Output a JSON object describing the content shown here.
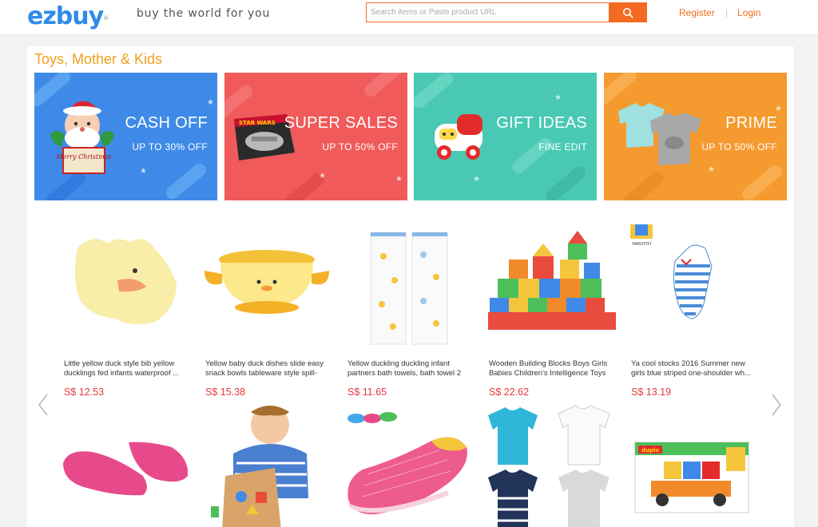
{
  "header": {
    "logo": "ezbuy",
    "tagline": "buy the world for you",
    "search_placeholder": "Search items or Paste product URL",
    "register": "Register",
    "separator": "|",
    "login": "Login"
  },
  "section": {
    "title": "Toys, Mother & Kids"
  },
  "banners": [
    {
      "headline": "CASH OFF",
      "sub": "UP TO 30% OFF",
      "color": "#3f8ae8",
      "art_text": "Merry Christmas"
    },
    {
      "headline": "SUPER SALES",
      "sub": "UP TO 50% OFF",
      "color": "#f05a5a",
      "art_text": "STAR WARS"
    },
    {
      "headline": "GIFT IDEAS",
      "sub": "FINE EDIT",
      "color": "#49c9b4",
      "art_text": ""
    },
    {
      "headline": "PRIME",
      "sub": "UP TO 50% OFF",
      "color": "#f59a2f",
      "art_text": ""
    }
  ],
  "products": [
    {
      "name": "Little yellow duck style bib yellow ducklings fed infants waterproof ...",
      "price": "S$ 12.53"
    },
    {
      "name": "Yellow baby duck dishes slide easy snack bowls tableware style spill-",
      "price": "S$ 15.38"
    },
    {
      "name": "Yellow duckling duckling infant partners bath towels, bath towel 2",
      "price": "S$ 11.65"
    },
    {
      "name": "Wooden Building Blocks Boys Girls Babies Children's Intelligence Toys",
      "price": "S$ 22.62"
    },
    {
      "name": "Ya cool stocks 2016 Summer new girls blue striped one-shoulder wh...",
      "price": "S$ 13.19"
    }
  ],
  "brand_badge": "YAKUYIYI",
  "lego_text": "duplo"
}
